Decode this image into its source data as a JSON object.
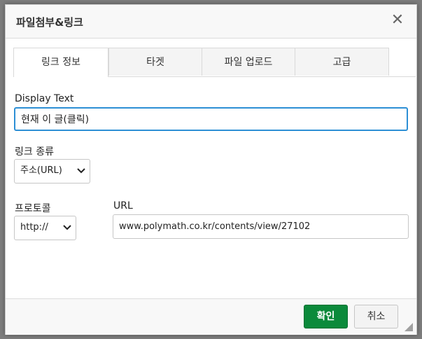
{
  "dialog": {
    "title": "파일첨부&링크",
    "close_glyph": "✕"
  },
  "tabs": [
    {
      "label": "링크 정보",
      "active": true
    },
    {
      "label": "타겟",
      "active": false
    },
    {
      "label": "파일 업로드",
      "active": false
    },
    {
      "label": "고급",
      "active": false
    }
  ],
  "form": {
    "display_text": {
      "label": "Display Text",
      "value": "현재 이 글(클릭)"
    },
    "link_type": {
      "label": "링크 종류",
      "selected": "주소(URL)"
    },
    "protocol": {
      "label": "프로토콜",
      "selected": "http://"
    },
    "url": {
      "label": "URL",
      "value": "www.polymath.co.kr/contents/view/27102"
    }
  },
  "footer": {
    "confirm_label": "확인",
    "cancel_label": "취소"
  },
  "colors": {
    "primary": "#0b8a3b",
    "focus": "#2d8fd5"
  }
}
